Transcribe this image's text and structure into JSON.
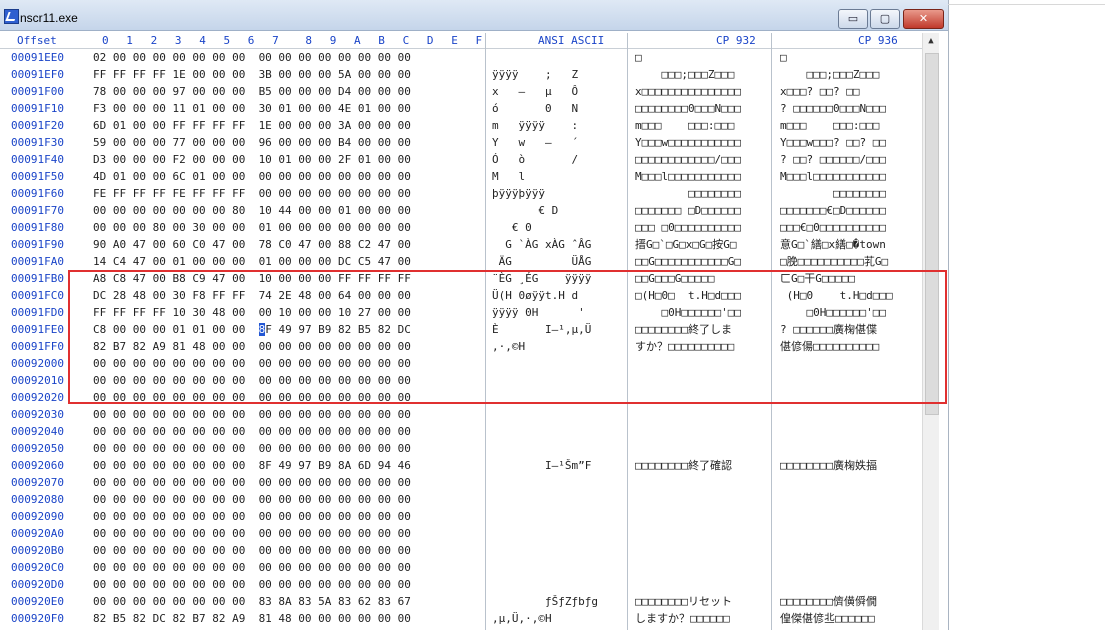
{
  "window": {
    "title": "nscr11.exe"
  },
  "controls": {
    "minimize": "▭",
    "maximize": "▢",
    "close": "✕"
  },
  "header": {
    "offset": "Offset",
    "hex_cols": [
      "0",
      "1",
      "2",
      "3",
      "4",
      "5",
      "6",
      "7",
      "8",
      "9",
      "A",
      "B",
      "C",
      "D",
      "E",
      "F"
    ],
    "ansi": "ANSI ASCII",
    "cp932": "CP 932",
    "cp936": "CP 936"
  },
  "cursor": {
    "row": 16,
    "col": 8,
    "value": "8"
  },
  "rows": [
    {
      "offset": "00091EE0",
      "hex": "02 00 00 00 00 00 00 00  00 00 00 00 00 00 00 00",
      "ansi": "",
      "cp932": "□",
      "cp936": "□"
    },
    {
      "offset": "00091EF0",
      "hex": "FF FF FF FF 1E 00 00 00  3B 00 00 00 5A 00 00 00",
      "ansi": "ÿÿÿÿ    ;   Z",
      "cp932": "    □□□;□□□Z□□□",
      "cp936": "    □□□;□□□Z□□□"
    },
    {
      "offset": "00091F00",
      "hex": "78 00 00 00 97 00 00 00  B5 00 00 00 D4 00 00 00",
      "ansi": "x   —   µ   Ô",
      "cp932": "x□□□□□□□□□□□□□□□",
      "cp936": "x□□□? □□? □□"
    },
    {
      "offset": "00091F10",
      "hex": "F3 00 00 00 11 01 00 00  30 01 00 00 4E 01 00 00",
      "ansi": "ó       0   N",
      "cp932": "□□□□□□□□0□□□N□□□",
      "cp936": "? □□□□□□0□□□N□□□"
    },
    {
      "offset": "00091F20",
      "hex": "6D 01 00 00 FF FF FF FF  1E 00 00 00 3A 00 00 00",
      "ansi": "m   ÿÿÿÿ    :",
      "cp932": "m□□□    □□□:□□□",
      "cp936": "m□□□    □□□:□□□"
    },
    {
      "offset": "00091F30",
      "hex": "59 00 00 00 77 00 00 00  96 00 00 00 B4 00 00 00",
      "ansi": "Y   w   –   ´",
      "cp932": "Y□□□w□□□□□□□□□□□",
      "cp936": "Y□□□w□□□? □□? □□"
    },
    {
      "offset": "00091F40",
      "hex": "D3 00 00 00 F2 00 00 00  10 01 00 00 2F 01 00 00",
      "ansi": "Ó   ò       /",
      "cp932": "□□□□□□□□□□□□/□□□",
      "cp936": "? □□? □□□□□□/□□□"
    },
    {
      "offset": "00091F50",
      "hex": "4D 01 00 00 6C 01 00 00  00 00 00 00 00 00 00 00",
      "ansi": "M   l",
      "cp932": "M□□□l□□□□□□□□□□□",
      "cp936": "M□□□l□□□□□□□□□□□"
    },
    {
      "offset": "00091F60",
      "hex": "FE FF FF FF FE FF FF FF  00 00 00 00 00 00 00 00",
      "ansi": "þÿÿÿþÿÿÿ",
      "cp932": "        □□□□□□□□",
      "cp936": "        □□□□□□□□"
    },
    {
      "offset": "00091F70",
      "hex": "00 00 00 00 00 00 00 80  10 44 00 00 01 00 00 00",
      "ansi": "       € D",
      "cp932": "□□□□□□□ □D□□□□□□",
      "cp936": "□□□□□□□€□D□□□□□□"
    },
    {
      "offset": "00091F80",
      "hex": "00 00 00 80 00 30 00 00  01 00 00 00 00 00 00 00",
      "ansi": "   € 0",
      "cp932": "□□□ □0□□□□□□□□□□",
      "cp936": "□□□€□0□□□□□□□□□□"
    },
    {
      "offset": "00091F90",
      "hex": "90 A0 47 00 60 C0 47 00  78 C0 47 00 88 C2 47 00",
      "ansi": "  G `ÀG xÀG ˆÂG",
      "cp932": "搢G□`□G□x□G□按G□",
      "cp936": "意G□`繕□x繕□�town"
    },
    {
      "offset": "00091FA0",
      "hex": "14 C4 47 00 01 00 00 00  01 00 00 00 DC C5 47 00",
      "ansi": " ÄG         ÜÅG",
      "cp932": "□□G□□□□□□□□□□□G□",
      "cp936": "□脕□□□□□□□□□□芤G□"
    },
    {
      "offset": "00091FB0",
      "hex": "A8 C8 47 00 B8 C9 47 00  10 00 00 00 FF FF FF FF",
      "ansi": "¨ÈG ¸ÉG    ÿÿÿÿ",
      "cp932": "□□G□□□G□□□□□    ",
      "cp936": "ㄈG□干G□□□□□    "
    },
    {
      "offset": "00091FC0",
      "hex": "DC 28 48 00 30 F8 FF FF  74 2E 48 00 64 00 00 00",
      "ansi": "Ü(H 0øÿÿt.H d",
      "cp932": "□(H□0□  t.H□d□□□",
      "cp936": " (H□0    t.H□d□□□"
    },
    {
      "offset": "00091FD0",
      "hex": "FF FF FF FF 10 30 48 00  00 10 00 00 10 27 00 00",
      "ansi": "ÿÿÿÿ 0H      '",
      "cp932": "    □0H□□□□□□'□□",
      "cp936": "    □0H□□□□□□'□□"
    },
    {
      "offset": "00091FE0",
      "hex": "C8 00 00 00 01 01 00 00  8F 49 97 B9 82 B5 82 DC",
      "ansi": "È       I–¹‚µ‚Ü",
      "cp932": "□□□□□□□□終了しま",
      "cp936": "? □□□□□□廣椈偡偞"
    },
    {
      "offset": "00091FF0",
      "hex": "82 B7 82 A9 81 48 00 00  00 00 00 00 00 00 00 00",
      "ansi": "‚·‚©H",
      "cp932": "すか？□□□□□□□□□□",
      "cp936": "偡偐偒□□□□□□□□□□"
    },
    {
      "offset": "00092000",
      "hex": "00 00 00 00 00 00 00 00  00 00 00 00 00 00 00 00",
      "ansi": "",
      "cp932": "",
      "cp936": ""
    },
    {
      "offset": "00092010",
      "hex": "00 00 00 00 00 00 00 00  00 00 00 00 00 00 00 00",
      "ansi": "",
      "cp932": "",
      "cp936": ""
    },
    {
      "offset": "00092020",
      "hex": "00 00 00 00 00 00 00 00  00 00 00 00 00 00 00 00",
      "ansi": "",
      "cp932": "",
      "cp936": ""
    },
    {
      "offset": "00092030",
      "hex": "00 00 00 00 00 00 00 00  00 00 00 00 00 00 00 00",
      "ansi": "",
      "cp932": "",
      "cp936": ""
    },
    {
      "offset": "00092040",
      "hex": "00 00 00 00 00 00 00 00  00 00 00 00 00 00 00 00",
      "ansi": "",
      "cp932": "",
      "cp936": ""
    },
    {
      "offset": "00092050",
      "hex": "00 00 00 00 00 00 00 00  00 00 00 00 00 00 00 00",
      "ansi": "",
      "cp932": "",
      "cp936": ""
    },
    {
      "offset": "00092060",
      "hex": "00 00 00 00 00 00 00 00  8F 49 97 B9 8A 6D 94 46",
      "ansi": "        I–¹Šm”F",
      "cp932": "□□□□□□□□終了確認",
      "cp936": "□□□□□□□□廣椈妷揊"
    },
    {
      "offset": "00092070",
      "hex": "00 00 00 00 00 00 00 00  00 00 00 00 00 00 00 00",
      "ansi": "",
      "cp932": "",
      "cp936": ""
    },
    {
      "offset": "00092080",
      "hex": "00 00 00 00 00 00 00 00  00 00 00 00 00 00 00 00",
      "ansi": "",
      "cp932": "",
      "cp936": ""
    },
    {
      "offset": "00092090",
      "hex": "00 00 00 00 00 00 00 00  00 00 00 00 00 00 00 00",
      "ansi": "",
      "cp932": "",
      "cp936": ""
    },
    {
      "offset": "000920A0",
      "hex": "00 00 00 00 00 00 00 00  00 00 00 00 00 00 00 00",
      "ansi": "",
      "cp932": "",
      "cp936": ""
    },
    {
      "offset": "000920B0",
      "hex": "00 00 00 00 00 00 00 00  00 00 00 00 00 00 00 00",
      "ansi": "",
      "cp932": "",
      "cp936": ""
    },
    {
      "offset": "000920C0",
      "hex": "00 00 00 00 00 00 00 00  00 00 00 00 00 00 00 00",
      "ansi": "",
      "cp932": "",
      "cp936": ""
    },
    {
      "offset": "000920D0",
      "hex": "00 00 00 00 00 00 00 00  00 00 00 00 00 00 00 00",
      "ansi": "",
      "cp932": "",
      "cp936": ""
    },
    {
      "offset": "000920E0",
      "hex": "00 00 00 00 00 00 00 00  83 8A 83 5A 83 62 83 67",
      "ansi": "        ƒŠƒZƒbƒg",
      "cp932": "□□□□□□□□リセット",
      "cp936": "□□□□□□□□儕僙僢僩"
    },
    {
      "offset": "000920F0",
      "hex": "82 B5 82 DC 82 B7 82 A9  81 48 00 00 00 00 00 00",
      "ansi": "‚µ‚Ü‚·‚©H",
      "cp932": "しますか？□□□□□□",
      "cp936": "偟傑偡偐丠□□□□□□"
    }
  ]
}
